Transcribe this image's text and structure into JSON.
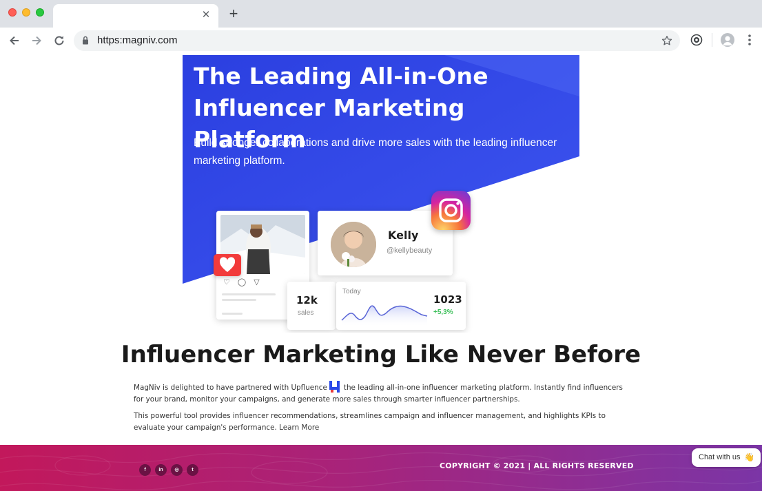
{
  "browser": {
    "url": "https:magniv.com",
    "tab_close_glyph": "✕",
    "new_tab_glyph": "+"
  },
  "hero": {
    "title_line1": "The Leading All-in-One",
    "title_line2": "Influencer Marketing Platform",
    "subtitle": "Build stronger collaborations and drive more sales with the leading influencer marketing platform.",
    "profile_name": "Kelly",
    "profile_handle": "@kellybeauty",
    "sales_value": "12k",
    "sales_label": "sales",
    "today_label": "Today",
    "today_value": "1023",
    "today_change": "+5,3%",
    "colors": {
      "blue": "#2f47e6",
      "instagram": "#d6249f",
      "heart": "#f23b3b",
      "positive": "#3cbf5a"
    }
  },
  "main": {
    "headline": "Influencer Marketing Like Never Before",
    "para1_before": "MagNiv is delighted to have partnered with Upfluence",
    "para1_after": "the leading all-in-one influencer marketing platform. Instantly find influencers for your brand, monitor your campaigns, and generate more sales through smarter influencer partnerships.",
    "para2": "This powerful tool provides influencer recommendations, streamlines campaign and influencer management, and highlights KPIs to evaluate your campaign's performance.",
    "learn_more": "Learn More"
  },
  "footer": {
    "social": [
      {
        "name": "facebook-icon",
        "glyph": "f"
      },
      {
        "name": "linkedin-icon",
        "glyph": "in"
      },
      {
        "name": "instagram-icon",
        "glyph": "◎"
      },
      {
        "name": "twitter-icon",
        "glyph": "t"
      }
    ],
    "copyright": "COPYRIGHT © 2021 | ALL RIGHTS RESERVED",
    "colors": {
      "start": "#c2185b",
      "end": "#7b35a6"
    }
  },
  "chat": {
    "label": "Chat with us",
    "emoji": "👋"
  }
}
